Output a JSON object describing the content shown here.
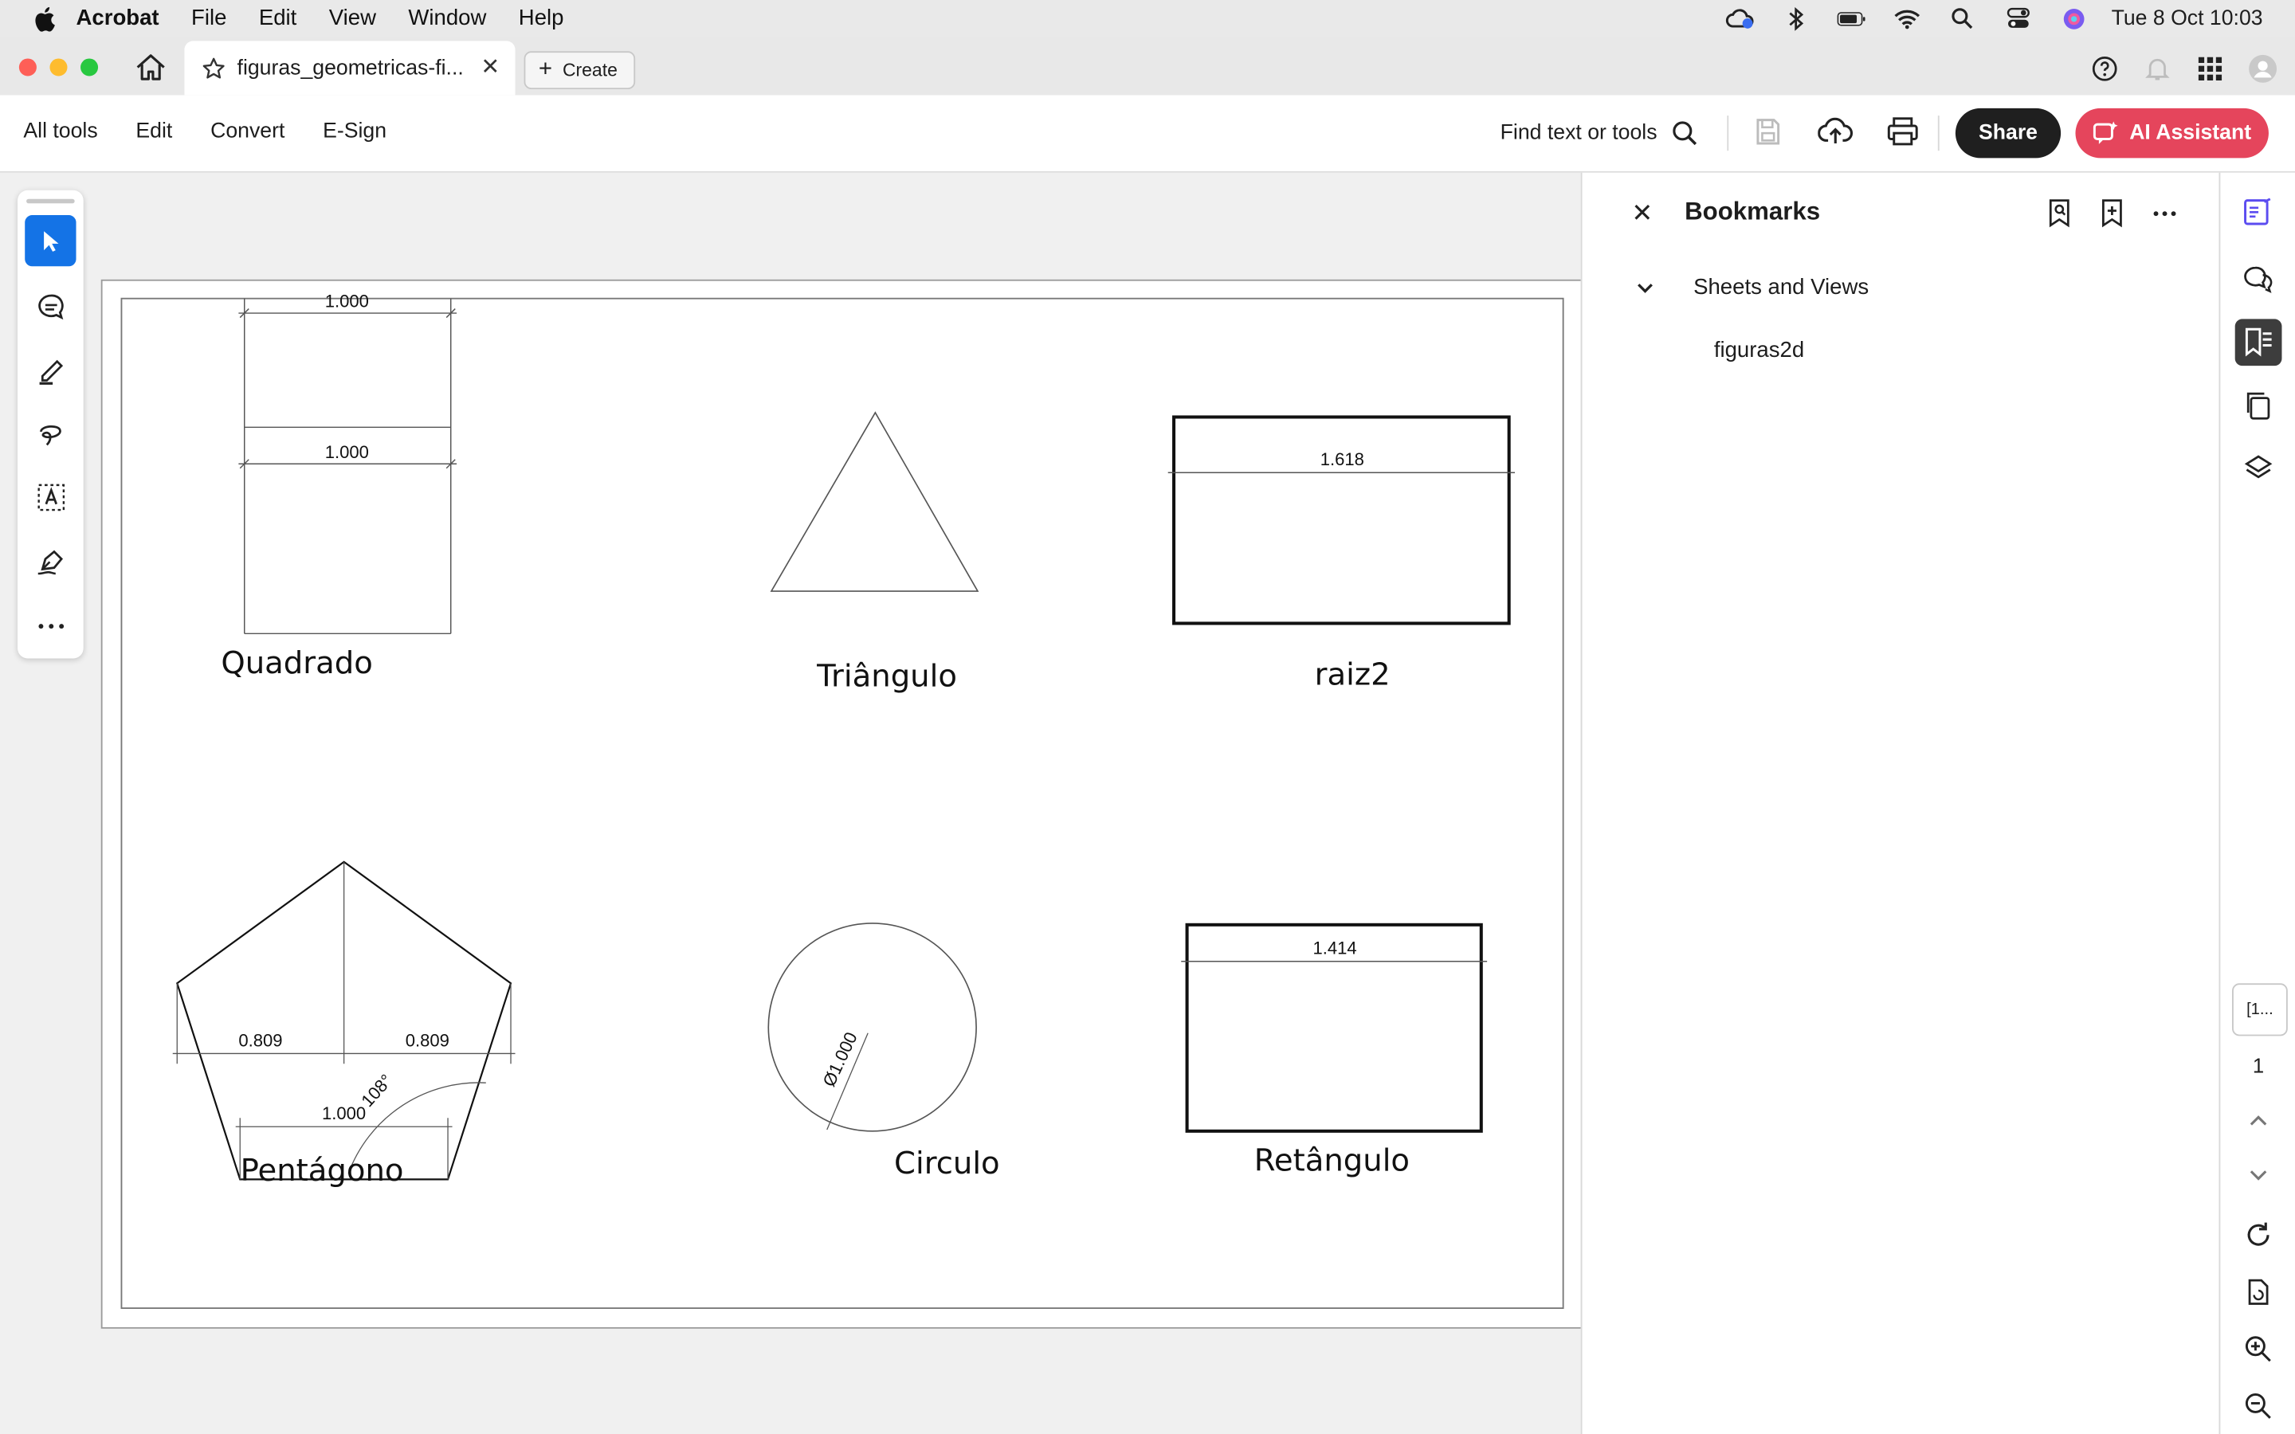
{
  "menubar": {
    "app_name": "Acrobat",
    "items": [
      "File",
      "Edit",
      "View",
      "Window",
      "Help"
    ],
    "clock": "Tue 8 Oct  10:03"
  },
  "tabbar": {
    "doc_tab_title": "figuras_geometricas-fi...",
    "create_label": "Create"
  },
  "toolbar": {
    "menus": [
      "All tools",
      "Edit",
      "Convert",
      "E-Sign"
    ],
    "find_label": "Find text or tools",
    "share_label": "Share",
    "ai_label": "AI Assistant"
  },
  "drawing": {
    "labels": {
      "square": "Quadrado",
      "triangle": "Triângulo",
      "raiz2": "raiz2",
      "pentagon": "Pentágono",
      "circle": "Circulo",
      "rectangle": "Retângulo"
    },
    "dimensions": {
      "square_top": "1.000",
      "square_mid": "1.000",
      "raiz2_width": "1.618",
      "rectangle_width": "1.414",
      "pentagon_left": "0.809",
      "pentagon_right": "0.809",
      "pentagon_base": "1.000",
      "pentagon_angle": "108°",
      "circle_diameter": "Ø1.000"
    }
  },
  "bookmarks": {
    "title": "Bookmarks",
    "items": [
      {
        "label": "Sheets and Views",
        "expanded": true
      },
      {
        "label": "figuras2d"
      }
    ]
  },
  "rail": {
    "page_box": "[1...",
    "page_number": "1"
  },
  "colors": {
    "accent_blue": "#1473e6",
    "ai_button": "#e5455c",
    "share_button": "#1f1f1f"
  }
}
